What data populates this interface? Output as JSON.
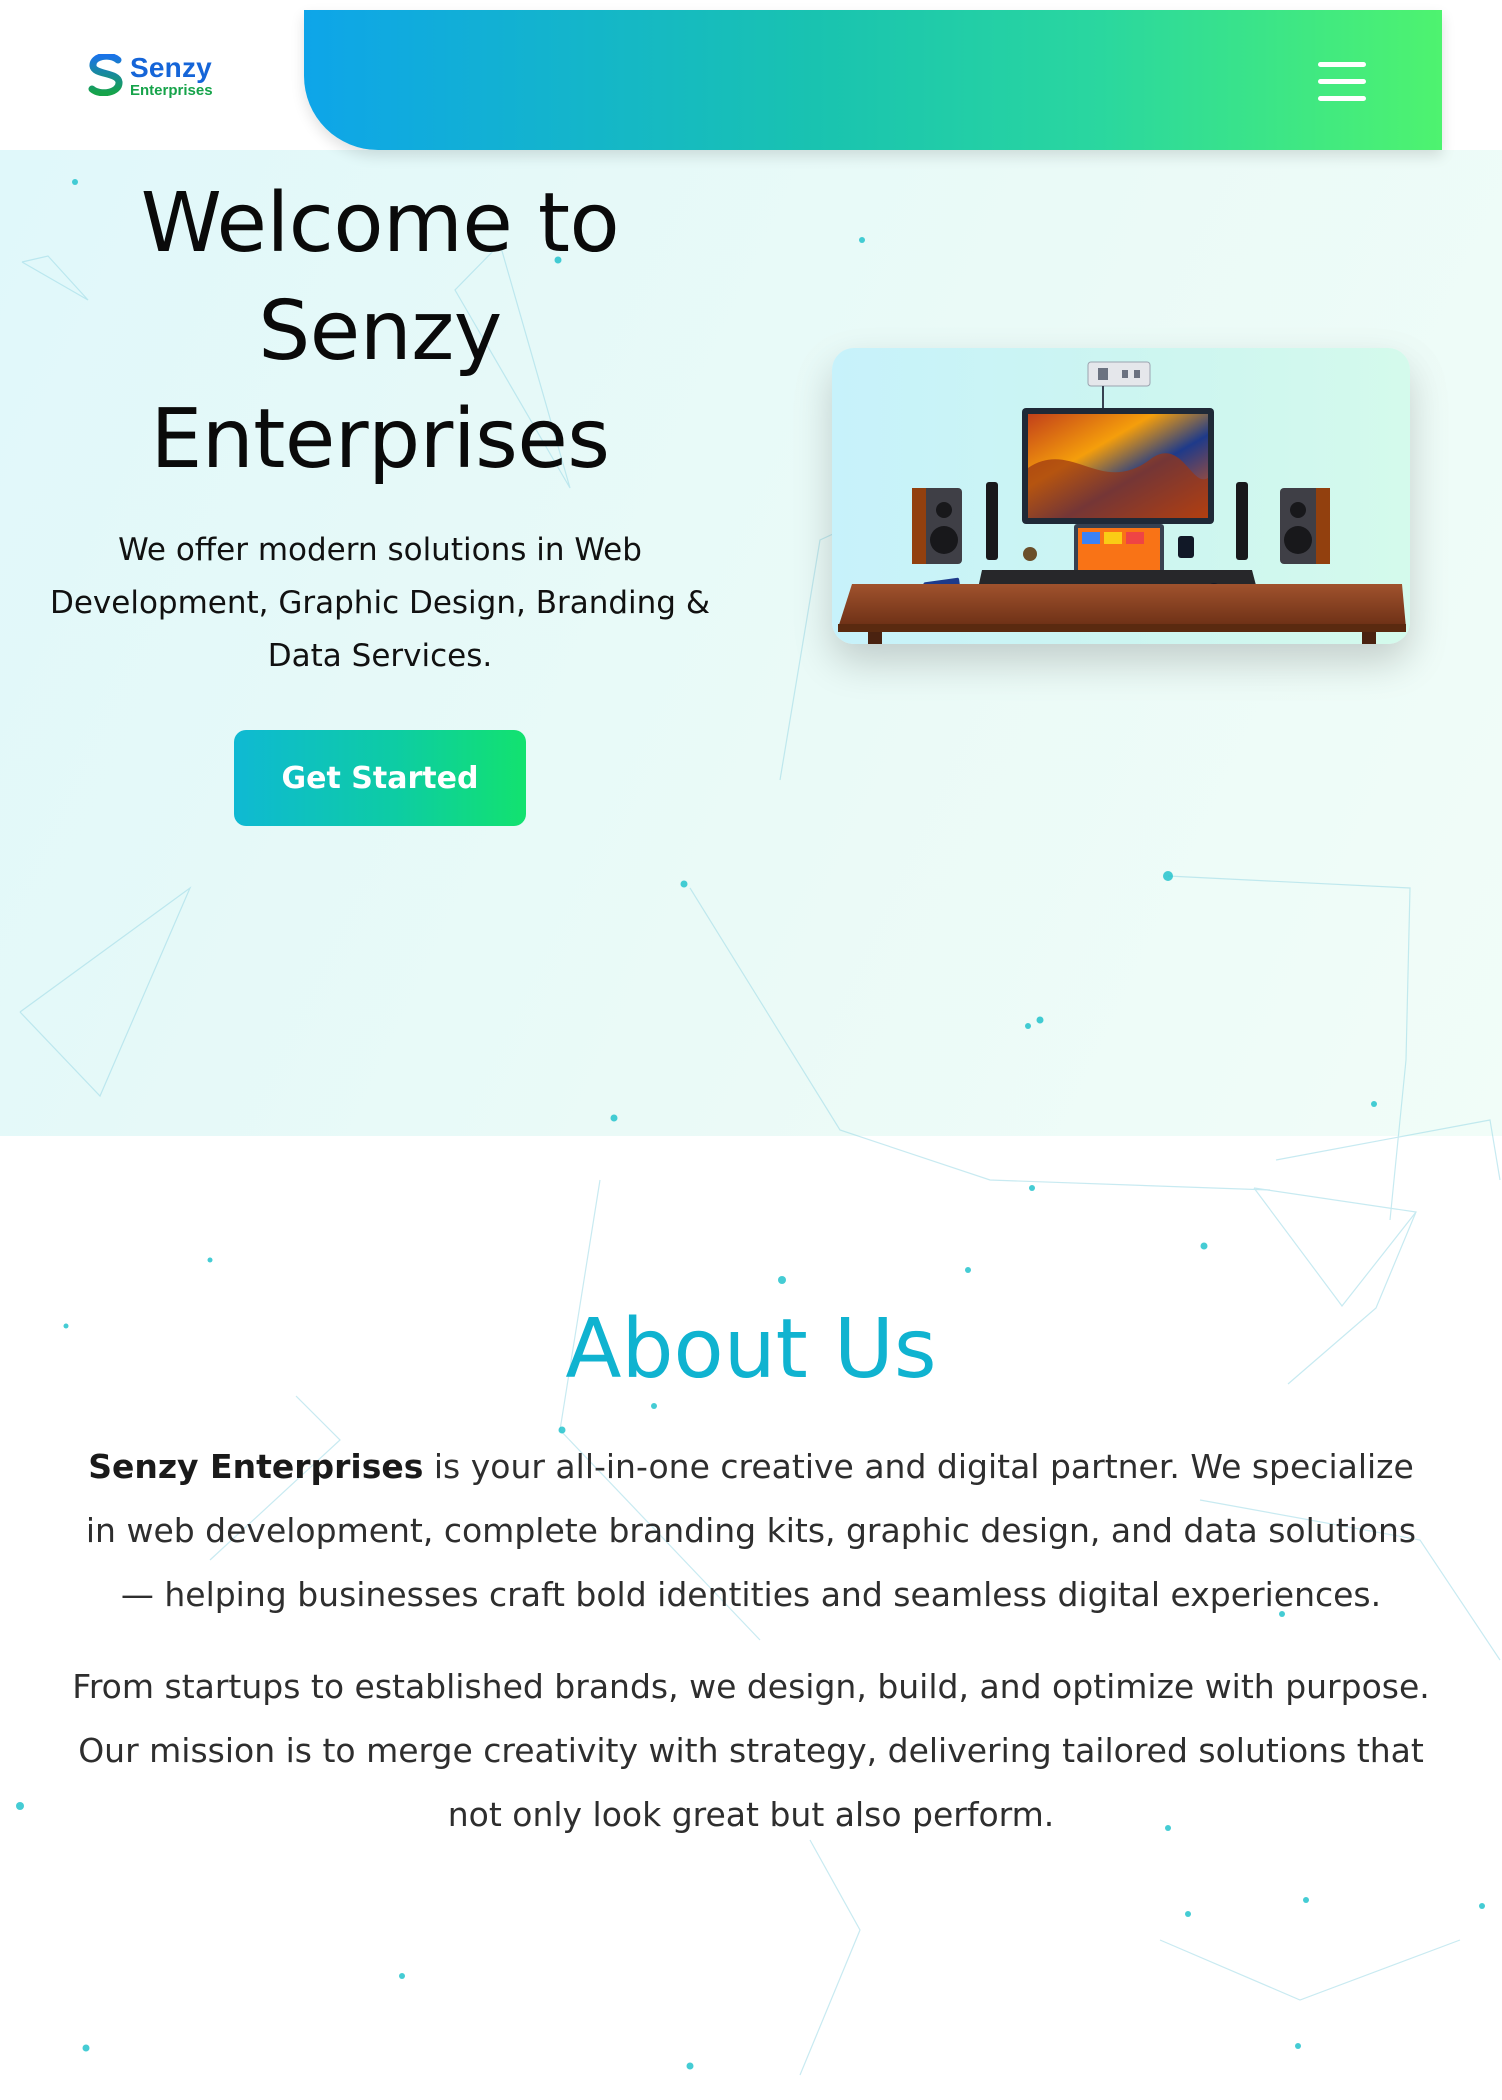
{
  "header": {
    "logo": {
      "name": "Senzy",
      "tagline": "Enterprises"
    },
    "menu_icon": "hamburger-menu-icon",
    "gradient_colors": [
      "#0ea5e9",
      "#4ef36f"
    ]
  },
  "hero": {
    "title": "Welcome to Senzy Enterprises",
    "subtitle": "We offer modern solutions in Web Development, Graphic Design, Branding & Data Services.",
    "cta_label": "Get Started"
  },
  "about": {
    "title": "About Us",
    "p1_brand": "Senzy Enterprises",
    "p1_rest": " is your all-in-one creative and digital partner. We specialize in web development, complete branding kits, graphic design, and data solutions — helping businesses craft bold identities and seamless digital experiences.",
    "p2": "From startups to established brands, we design, build, and optimize with purpose. Our mission is to merge creativity with strategy, delivering tailored solutions that not only look great but also perform."
  },
  "colors": {
    "accent": "#10b3d0",
    "brand_blue": "#1565d8",
    "brand_green": "#16a34a"
  }
}
